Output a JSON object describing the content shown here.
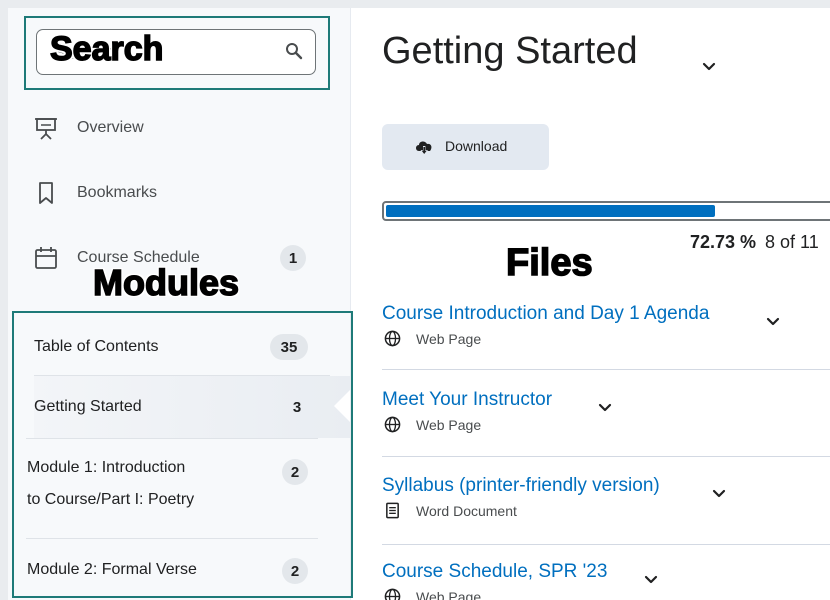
{
  "search": {
    "placeholder": "Search",
    "overlay_label": "Search"
  },
  "sidebar": {
    "items": [
      {
        "label": "Overview",
        "icon": "presentation-icon"
      },
      {
        "label": "Bookmarks",
        "icon": "bookmark-icon"
      },
      {
        "label": "Course Schedule",
        "icon": "calendar-icon",
        "count": "1"
      }
    ],
    "modules_overlay_label": "Modules",
    "toc": {
      "label": "Table of Contents",
      "count": "35"
    },
    "modules": [
      {
        "label": "Getting Started",
        "count": "3",
        "active": true
      },
      {
        "label_line1": "Module 1: Introduction",
        "label_line2": "to Course/Part I: Poetry",
        "count": "2"
      },
      {
        "label": "Module 2: Formal Verse",
        "count": "2"
      }
    ]
  },
  "main": {
    "title": "Getting Started",
    "download_label": "Download",
    "progress": {
      "percent_text": "72.73 %",
      "count_text": "8 of 11",
      "fraction": 0.7273
    },
    "files_overlay_label": "Files",
    "files": [
      {
        "title": "Course Introduction and Day 1 Agenda",
        "type": "Web Page",
        "icon": "globe-icon"
      },
      {
        "title": "Meet Your Instructor",
        "type": "Web Page",
        "icon": "globe-icon"
      },
      {
        "title": "Syllabus (printer-friendly version)",
        "type": "Word Document",
        "icon": "document-icon"
      },
      {
        "title": "Course Schedule, SPR '23",
        "type": "Web Page",
        "icon": "globe-icon"
      }
    ]
  },
  "colors": {
    "accent": "#006fbf",
    "highlight_border": "#1e7a78",
    "sidebar_bg": "#f7f9fb"
  }
}
